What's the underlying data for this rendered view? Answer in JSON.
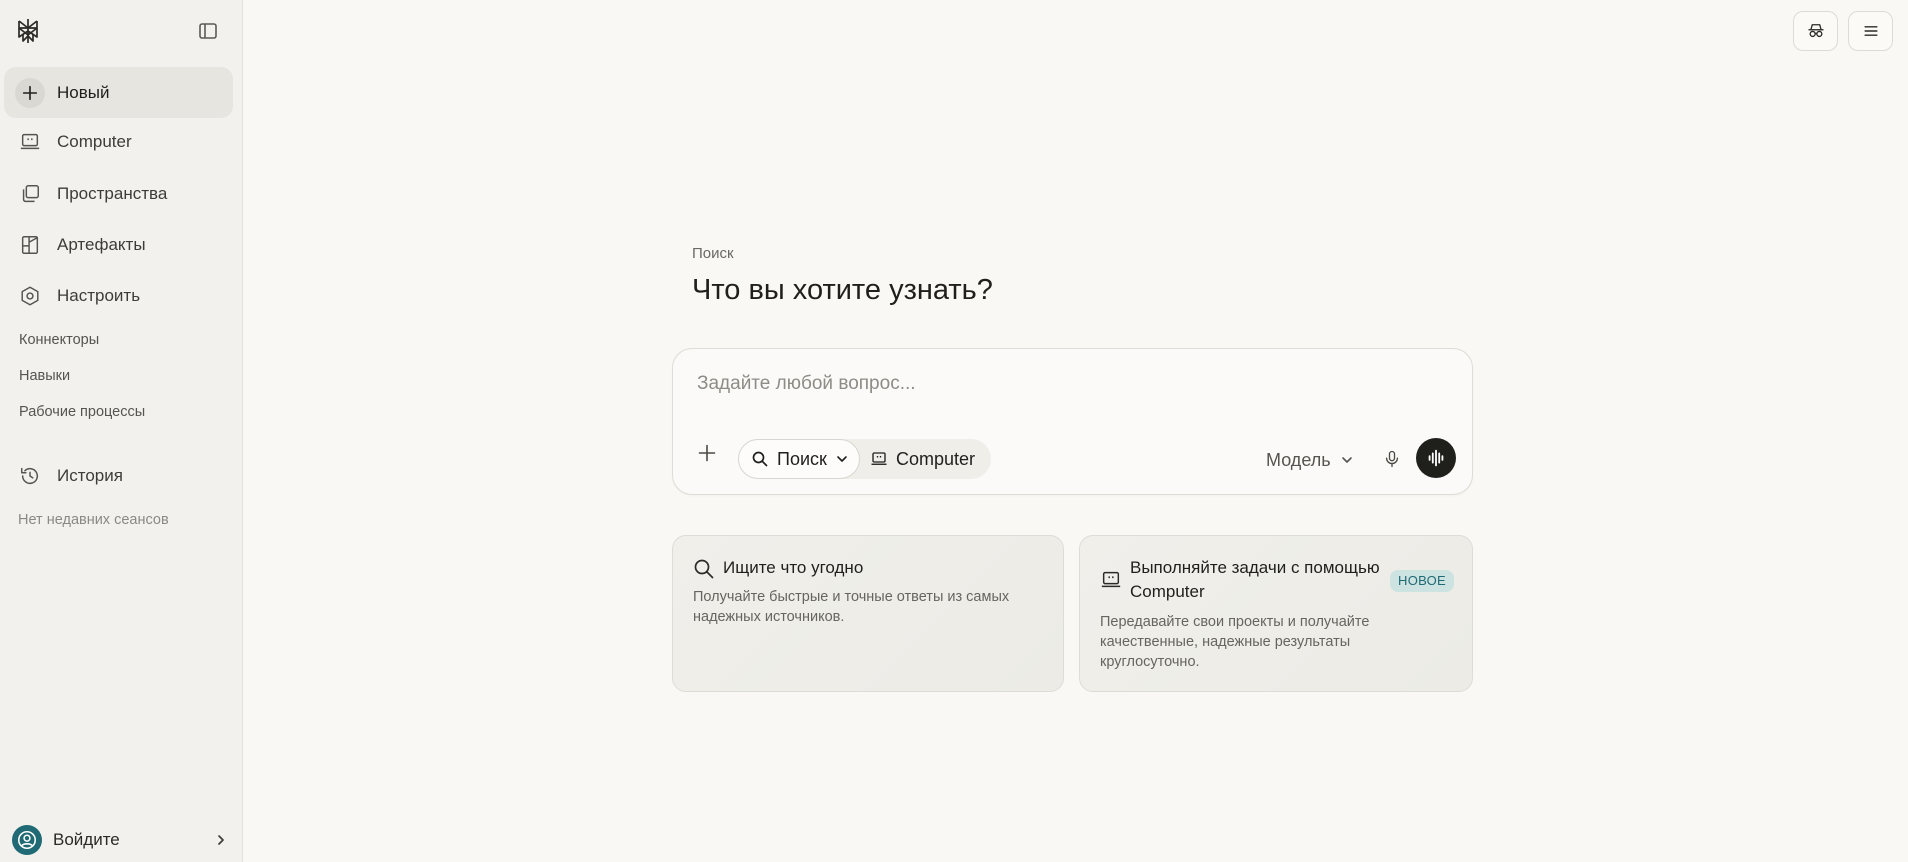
{
  "sidebar": {
    "new_label": "Новый",
    "items": [
      {
        "label": "Computer"
      },
      {
        "label": "Пространства"
      },
      {
        "label": "Артефакты"
      },
      {
        "label": "Настроить"
      }
    ],
    "sub_links": [
      "Коннекторы",
      "Навыки",
      "Рабочие процессы"
    ],
    "history_label": "История",
    "no_sessions": "Нет недавних сеансов",
    "signin_label": "Войдите"
  },
  "main": {
    "kicker": "Поиск",
    "headline": "Что вы хотите узнать?",
    "composer": {
      "placeholder": "Задайте любой вопрос...",
      "mode_search": "Поиск",
      "mode_computer": "Computer",
      "model_label": "Модель"
    },
    "cards": [
      {
        "title": "Ищите что угодно",
        "desc_line1": "Получайте быстрые и точные ответы из самых",
        "desc_line2": "надежных источников."
      },
      {
        "title_line1": "Выполняйте задачи с помощью",
        "title_line2": "Computer",
        "badge": "НОВОЕ",
        "desc_line1": "Передавайте свои проекты и получайте",
        "desc_line2": "качественные, надежные результаты",
        "desc_line3": "круглосуточно."
      }
    ]
  },
  "colors": {
    "background": "#f9f8f5",
    "sidebar": "#f2f1ee",
    "accent_teal": "#1f6a74",
    "badge_bg": "#cde3e2",
    "dark": "#1f1f1c"
  },
  "icons": [
    "perplexity-logo-icon",
    "sidebar-toggle-icon",
    "plus-icon",
    "computer-icon",
    "spaces-icon",
    "artifacts-icon",
    "customize-icon",
    "history-icon",
    "user-icon",
    "chevron-right-icon",
    "incognito-icon",
    "menu-icon",
    "search-icon",
    "chevron-down-icon",
    "microphone-icon",
    "voice-wave-icon"
  ]
}
